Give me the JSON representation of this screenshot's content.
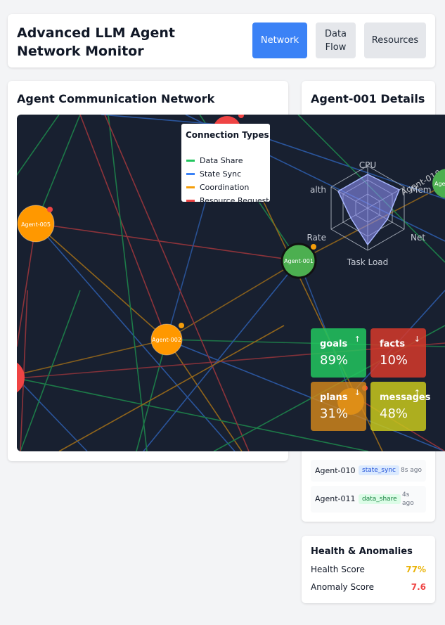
{
  "header": {
    "title": "Advanced LLM Agent Network Monitor",
    "buttons": [
      "Network",
      "Data Flow",
      "Resources"
    ]
  },
  "network": {
    "title": "Agent Communication Network",
    "legend": {
      "title": "Connection Types",
      "items": [
        {
          "label": "Data Share",
          "color": "#22c55e"
        },
        {
          "label": "State Sync",
          "color": "#3b82f6"
        },
        {
          "label": "Coordination",
          "color": "#f59e0b"
        },
        {
          "label": "Resource Request",
          "color": "#ef4444"
        }
      ]
    },
    "nodes": [
      {
        "id": "Agent-001",
        "color": "#4caf50",
        "status_color": "#f59e0b"
      },
      {
        "id": "Agent-002",
        "color": "#ff9800",
        "status_color": "#f59e0b"
      },
      {
        "id": "Agent-005",
        "color": "#ff9800",
        "status_color": "#ef4444"
      },
      {
        "id": "Age",
        "color": "#4caf50"
      }
    ],
    "radar": {
      "axes": [
        "CPU",
        "Mem",
        "Net",
        "Task Load",
        "Rate",
        "alth"
      ],
      "overlay_text": "Agent-010"
    },
    "metrics": [
      {
        "name": "goals",
        "value": "89%",
        "arrow": "↑",
        "color": "#22c55e"
      },
      {
        "name": "facts",
        "value": "10%",
        "arrow": "↓",
        "color": "#d63a2a"
      },
      {
        "name": "plans",
        "value": "31%",
        "arrow": "↓",
        "color": "#d88a1a"
      },
      {
        "name": "messages",
        "value": "48%",
        "arrow": "↑",
        "color": "#c8c81c"
      }
    ]
  },
  "details": {
    "title": "Agent-001 Details",
    "messages": [
      {
        "agent": "Agent-010",
        "type": "state_sync",
        "time": "8s ago"
      },
      {
        "agent": "Agent-011",
        "type": "data_share",
        "time": "4s ago"
      }
    ]
  },
  "health": {
    "title": "Health & Anomalies",
    "health_label": "Health Score",
    "health_value": "77%",
    "health_color": "#eab308",
    "anomaly_label": "Anomaly Score",
    "anomaly_value": "7.6",
    "anomaly_color": "#ef4444"
  }
}
